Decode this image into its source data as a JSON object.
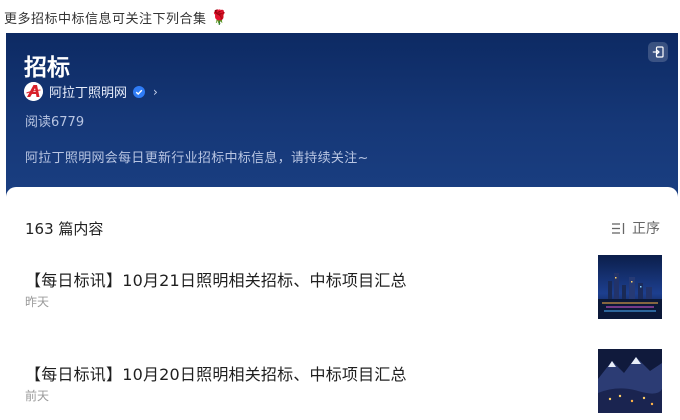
{
  "top_note": {
    "text": "更多招标中标信息可关注下列合集",
    "emoji": "🌹"
  },
  "header": {
    "title": "招标",
    "account_name": "阿拉丁照明网",
    "logo_letter": "A",
    "read_count": "阅读6779",
    "description": "阿拉丁照明网会每日更新行业招标中标信息，请持续关注~"
  },
  "list": {
    "count_label": "163 篇内容",
    "sort_label": "正序",
    "articles": [
      {
        "title": "【每日标讯】10月21日照明相关招标、中标项目汇总",
        "time": "昨天"
      },
      {
        "title": "【每日标讯】10月20日照明相关招标、中标项目汇总",
        "time": "前天"
      }
    ]
  },
  "colors": {
    "header_top": "#0d2a63",
    "header_bottom": "#1a3f82",
    "logo_red": "#d8202a",
    "verify_blue": "#2f7cf6"
  }
}
